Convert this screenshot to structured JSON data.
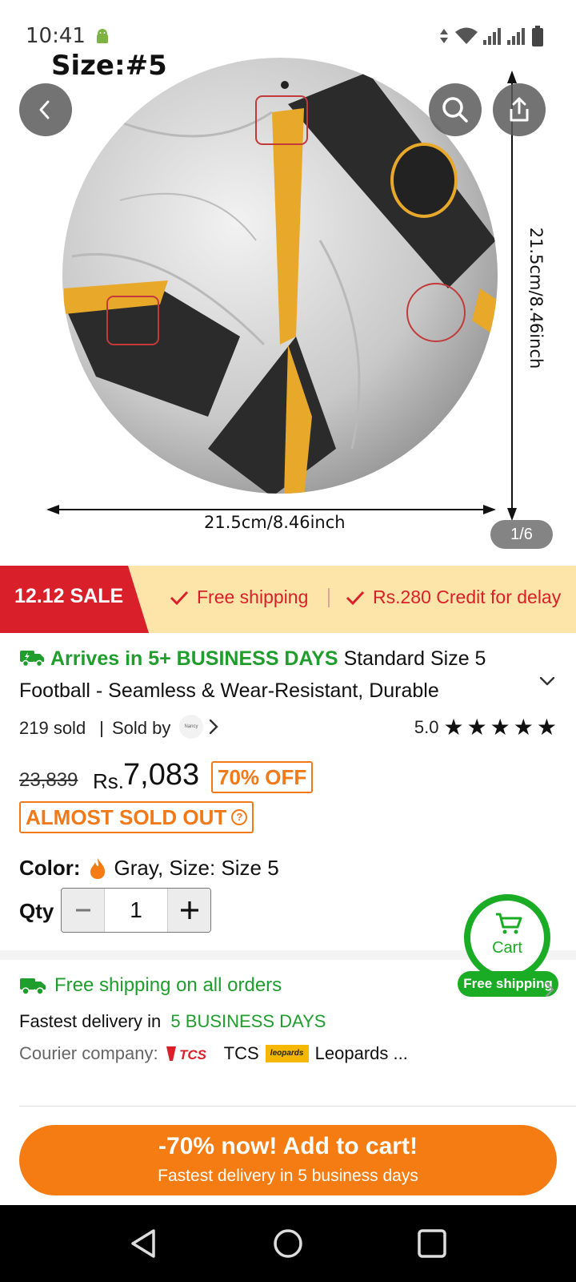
{
  "status_bar": {
    "time": "10:41"
  },
  "hero": {
    "size_label": "Size:#5",
    "dimension_horizontal": "21.5cm/8.46inch",
    "dimension_vertical": "21.5cm/8.46inch",
    "page_indicator": "1/6",
    "image_index": 1,
    "image_count": 6
  },
  "sale_banner": {
    "tag": "12.12 SALE",
    "perk_1": "Free shipping",
    "perk_2": "Rs.280 Credit for delay"
  },
  "product": {
    "arrives": "Arrives in 5+ BUSINESS DAYS",
    "title": "Standard Size 5 Football - Seamless & Wear-Resistant, Durable",
    "sold": "219 sold",
    "sold_by_label": "Sold by",
    "seller_logo_text": "Nancy",
    "rating": "5.0",
    "stars": 5,
    "old_price": "23,839",
    "currency": "Rs.",
    "price": "7,083",
    "discount": "70% OFF",
    "stock_status": "ALMOST SOLD OUT",
    "color_label": "Color:",
    "color_value": "Gray, Size: Size 5",
    "qty_label": "Qty",
    "qty_value": "1"
  },
  "cart_fab": {
    "label": "Cart",
    "badge": "Free shipping"
  },
  "shipping": {
    "headline": "Free shipping on all orders",
    "fastest_label": "Fastest delivery in",
    "fastest_value": "5 BUSINESS DAYS",
    "courier_label": "Courier company:",
    "courier_1": "TCS",
    "courier_1_logo": "TCS",
    "courier_2": "Leopards ...",
    "courier_2_logo": "leopards"
  },
  "cta": {
    "main": "-70% now! Add to cart!",
    "sub": "Fastest delivery in 5 business days"
  },
  "colors": {
    "sale_red": "#d9202a",
    "banner_bg": "#fde4a8",
    "green": "#1f9d2d",
    "orange": "#f57c12"
  }
}
